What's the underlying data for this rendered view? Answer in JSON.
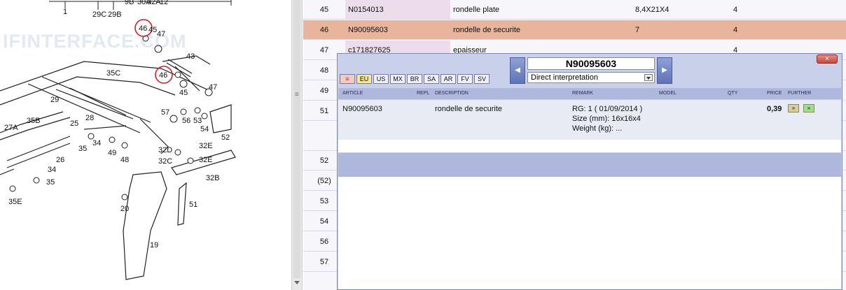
{
  "diagram": {
    "watermark": "IFINTERFACE.COM",
    "top_labels": [
      "1",
      "29C",
      "29B",
      "9B",
      "30A",
      "32A",
      "12"
    ],
    "labels": [
      "46",
      "45",
      "47",
      "43",
      "35C",
      "46",
      "45",
      "47",
      "29",
      "28",
      "57",
      "56",
      "53",
      "54",
      "52",
      "27A",
      "35B",
      "25",
      "34",
      "35",
      "49",
      "48",
      "32D",
      "32E",
      "32C",
      "32E",
      "26",
      "34",
      "35",
      "32B",
      "35E",
      "20",
      "51",
      "19"
    ],
    "highlighted": [
      "46",
      "46"
    ]
  },
  "table": {
    "rows": [
      {
        "num": "45",
        "article": "N0154013",
        "description": "rondelle plate",
        "remark": "8,4X21X4",
        "qty": "4",
        "highlight": false
      },
      {
        "num": "46",
        "article": "N90095603",
        "description": "rondelle de securite",
        "remark": "7",
        "qty": "4",
        "highlight": true
      },
      {
        "num": "47",
        "article": "c171827625",
        "description": "epaisseur",
        "remark": "",
        "qty": "4",
        "highlight": false
      },
      {
        "num": "48"
      },
      {
        "num": "49"
      },
      {
        "num": "51"
      },
      {
        "num": ""
      },
      {
        "num": "52"
      },
      {
        "num": "(52)"
      },
      {
        "num": "53"
      },
      {
        "num": "54"
      },
      {
        "num": "56"
      },
      {
        "num": "57"
      }
    ]
  },
  "popup": {
    "close_label": "×",
    "prev_label": "◀",
    "next_label": "▶",
    "article": "N90095603",
    "interpretation": "Direct interpretation",
    "markets": [
      "≡",
      "EU",
      "US",
      "MX",
      "BR",
      "SA",
      "AR",
      "FV",
      "SV"
    ],
    "active_market": "EU",
    "headers": {
      "article": "ARTICLE",
      "repl": "REPL",
      "description": "DESCRIPTION",
      "remark": "REMARK",
      "model": "MODEL",
      "qty": "QTY",
      "price": "PRICE",
      "further": "FURTHER"
    },
    "detail": {
      "article": "N90095603",
      "description": "rondelle de securite",
      "remark_line1": "RG: 1 ( 01/09/2014 )",
      "remark_line2": "Size (mm): 16x16x4",
      "remark_line3": "Weight (kg): ...",
      "price": "0,39",
      "btn1": "»",
      "btn2": "»"
    }
  },
  "splitter": {
    "grip": "≡"
  },
  "colors": {
    "highlight_row": "#e8b49c",
    "article_cell": "#ecdcec",
    "popup_bg": "#c9d1ea",
    "header_bg": "#aeb8dc",
    "circle": "#d0202a"
  }
}
